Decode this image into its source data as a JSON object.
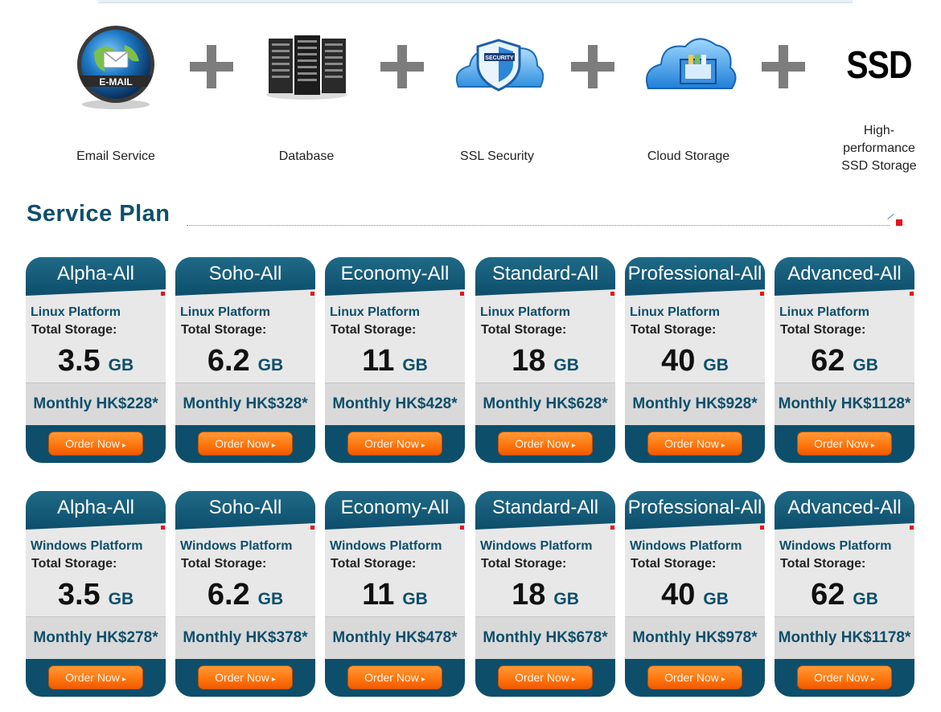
{
  "features": [
    {
      "label": "Email Service",
      "icon": "email-globe-icon",
      "badge": "E-MAIL"
    },
    {
      "label": "Database",
      "icon": "server-rack-icon"
    },
    {
      "label": "SSL Security",
      "icon": "ssl-cloud-shield-icon",
      "badge": "SECURITY"
    },
    {
      "label": "Cloud Storage",
      "icon": "cloud-drawer-icon"
    },
    {
      "label": "High-performance SSD Storage",
      "label_lines": [
        "High-",
        "performance",
        "SSD Storage"
      ],
      "icon": "ssd-text-icon",
      "badge": "SSD"
    }
  ],
  "section": {
    "title": "Service Plan"
  },
  "plans": [
    {
      "name": "Alpha-All",
      "platform": "Linux Platform",
      "storage_label": "Total Storage:",
      "size": "3.5",
      "unit": "GB",
      "price": "Monthly HK$228*",
      "order": "Order Now"
    },
    {
      "name": "Soho-All",
      "platform": "Linux Platform",
      "storage_label": "Total Storage:",
      "size": "6.2",
      "unit": "GB",
      "price": "Monthly HK$328*",
      "order": "Order Now"
    },
    {
      "name": "Economy-All",
      "platform": "Linux Platform",
      "storage_label": "Total Storage:",
      "size": "11",
      "unit": "GB",
      "price": "Monthly HK$428*",
      "order": "Order Now"
    },
    {
      "name": "Standard-All",
      "platform": "Linux Platform",
      "storage_label": "Total Storage:",
      "size": "18",
      "unit": "GB",
      "price": "Monthly HK$628*",
      "order": "Order Now"
    },
    {
      "name": "Professional-All",
      "platform": "Linux Platform",
      "storage_label": "Total Storage:",
      "size": "40",
      "unit": "GB",
      "price": "Monthly HK$928*",
      "order": "Order Now"
    },
    {
      "name": "Advanced-All",
      "platform": "Linux Platform",
      "storage_label": "Total Storage:",
      "size": "62",
      "unit": "GB",
      "price": "Monthly HK$1128*",
      "order": "Order Now"
    },
    {
      "name": "Alpha-All",
      "platform": "Windows Platform",
      "storage_label": "Total Storage:",
      "size": "3.5",
      "unit": "GB",
      "price": "Monthly HK$278*",
      "order": "Order Now"
    },
    {
      "name": "Soho-All",
      "platform": "Windows Platform",
      "storage_label": "Total Storage:",
      "size": "6.2",
      "unit": "GB",
      "price": "Monthly HK$378*",
      "order": "Order Now"
    },
    {
      "name": "Economy-All",
      "platform": "Windows Platform",
      "storage_label": "Total Storage:",
      "size": "11",
      "unit": "GB",
      "price": "Monthly HK$478*",
      "order": "Order Now"
    },
    {
      "name": "Standard-All",
      "platform": "Windows Platform",
      "storage_label": "Total Storage:",
      "size": "18",
      "unit": "GB",
      "price": "Monthly HK$678*",
      "order": "Order Now"
    },
    {
      "name": "Professional-All",
      "platform": "Windows Platform",
      "storage_label": "Total Storage:",
      "size": "40",
      "unit": "GB",
      "price": "Monthly HK$978*",
      "order": "Order Now"
    },
    {
      "name": "Advanced-All",
      "platform": "Windows Platform",
      "storage_label": "Total Storage:",
      "size": "62",
      "unit": "GB",
      "price": "Monthly HK$1178*",
      "order": "Order Now"
    }
  ],
  "colors": {
    "brand": "#0c4f6b",
    "order_button": "#ff7a10",
    "accent_red": "#e3141c",
    "card_body": "#e8e8e8"
  }
}
